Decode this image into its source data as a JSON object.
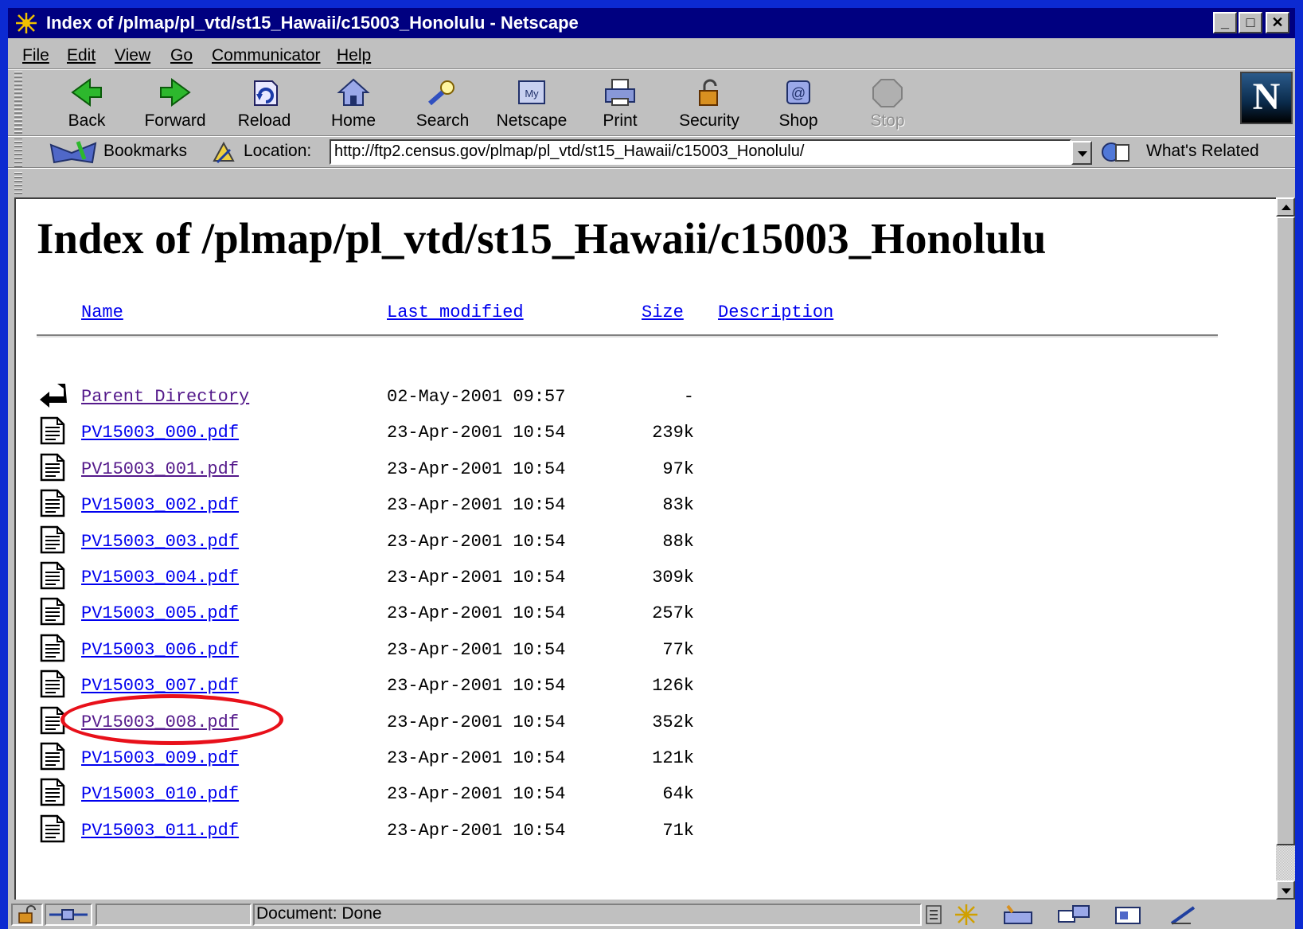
{
  "window": {
    "title": "Index of /plmap/pl_vtd/st15_Hawaii/c15003_Honolulu - Netscape",
    "minimize": "_",
    "maximize": "□",
    "close": "✕"
  },
  "menu": [
    {
      "label": "File"
    },
    {
      "label": "Edit"
    },
    {
      "label": "View"
    },
    {
      "label": "Go"
    },
    {
      "label": "Communicator"
    },
    {
      "label": "Help"
    }
  ],
  "toolbar": {
    "back": "Back",
    "forward": "Forward",
    "reload": "Reload",
    "home": "Home",
    "search": "Search",
    "netscape": "Netscape",
    "print": "Print",
    "security": "Security",
    "shop": "Shop",
    "stop": "Stop",
    "logo": "N"
  },
  "location": {
    "bookmarks": "Bookmarks",
    "label": "Location:",
    "url": "http://ftp2.census.gov/plmap/pl_vtd/st15_Hawaii/c15003_Honolulu/",
    "whats_related": "What's Related"
  },
  "page": {
    "heading": "Index of /plmap/pl_vtd/st15_Hawaii/c15003_Honolulu",
    "columns": {
      "name": "Name",
      "modified": "Last modified",
      "size": "Size",
      "description": "Description"
    },
    "rows": [
      {
        "name": "Parent Directory",
        "date": "02-May-2001 09:57",
        "size": "-",
        "icon": "back-arrow-icon",
        "visited": true
      },
      {
        "name": "PV15003_000.pdf",
        "date": "23-Apr-2001 10:54",
        "size": "239k",
        "icon": "document-icon",
        "visited": false
      },
      {
        "name": "PV15003_001.pdf",
        "date": "23-Apr-2001 10:54",
        "size": "97k",
        "icon": "document-icon",
        "visited": true
      },
      {
        "name": "PV15003_002.pdf",
        "date": "23-Apr-2001 10:54",
        "size": "83k",
        "icon": "document-icon",
        "visited": false
      },
      {
        "name": "PV15003_003.pdf",
        "date": "23-Apr-2001 10:54",
        "size": "88k",
        "icon": "document-icon",
        "visited": false
      },
      {
        "name": "PV15003_004.pdf",
        "date": "23-Apr-2001 10:54",
        "size": "309k",
        "icon": "document-icon",
        "visited": false
      },
      {
        "name": "PV15003_005.pdf",
        "date": "23-Apr-2001 10:54",
        "size": "257k",
        "icon": "document-icon",
        "visited": false
      },
      {
        "name": "PV15003_006.pdf",
        "date": "23-Apr-2001 10:54",
        "size": "77k",
        "icon": "document-icon",
        "visited": false
      },
      {
        "name": "PV15003_007.pdf",
        "date": "23-Apr-2001 10:54",
        "size": "126k",
        "icon": "document-icon",
        "visited": false
      },
      {
        "name": "PV15003_008.pdf",
        "date": "23-Apr-2001 10:54",
        "size": "352k",
        "icon": "document-icon",
        "visited": true,
        "highlighted": true
      },
      {
        "name": "PV15003_009.pdf",
        "date": "23-Apr-2001 10:54",
        "size": "121k",
        "icon": "document-icon",
        "visited": false
      },
      {
        "name": "PV15003_010.pdf",
        "date": "23-Apr-2001 10:54",
        "size": "64k",
        "icon": "document-icon",
        "visited": false
      },
      {
        "name": "PV15003_011.pdf",
        "date": "23-Apr-2001 10:54",
        "size": "71k",
        "icon": "document-icon",
        "visited": false
      }
    ]
  },
  "status": {
    "text": "Document: Done"
  },
  "colors": {
    "desktop": "#0c2ad1",
    "titlebar": "#000080",
    "link": "#0000ee",
    "visited_link": "#551a8b",
    "highlight_ring": "#e8101a"
  }
}
